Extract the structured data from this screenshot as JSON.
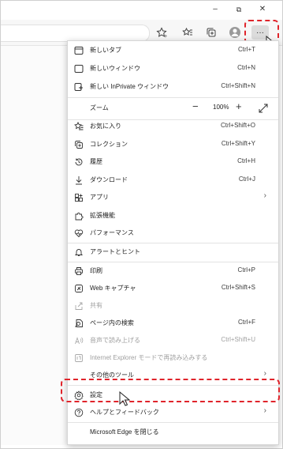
{
  "window": {
    "minimize": "–",
    "restore": "⧉",
    "close": "✕"
  },
  "toolbar": {
    "more_label": "···"
  },
  "menu": {
    "new_tab": {
      "label": "新しいタブ",
      "shortcut": "Ctrl+T"
    },
    "new_window": {
      "label": "新しいウィンドウ",
      "shortcut": "Ctrl+N"
    },
    "new_inprivate": {
      "label": "新しい InPrivate ウィンドウ",
      "shortcut": "Ctrl+Shift+N"
    },
    "zoom": {
      "label": "ズーム",
      "minus": "−",
      "value": "100%",
      "plus": "+"
    },
    "favorites": {
      "label": "お気に入り",
      "shortcut": "Ctrl+Shift+O"
    },
    "collections": {
      "label": "コレクション",
      "shortcut": "Ctrl+Shift+Y"
    },
    "history": {
      "label": "履歴",
      "shortcut": "Ctrl+H"
    },
    "downloads": {
      "label": "ダウンロード",
      "shortcut": "Ctrl+J"
    },
    "apps": {
      "label": "アプリ"
    },
    "extensions": {
      "label": "拡張機能"
    },
    "performance": {
      "label": "パフォーマンス"
    },
    "alerts": {
      "label": "アラートとヒント"
    },
    "print": {
      "label": "印刷",
      "shortcut": "Ctrl+P"
    },
    "web_capture": {
      "label": "Web キャプチャ",
      "shortcut": "Ctrl+Shift+S"
    },
    "share": {
      "label": "共有"
    },
    "find": {
      "label": "ページ内の検索",
      "shortcut": "Ctrl+F"
    },
    "read_aloud": {
      "label": "音声で読み上げる",
      "shortcut": "Ctrl+Shift+U"
    },
    "ie_mode": {
      "label": "Internet Explorer モードで再読み込みする"
    },
    "more_tools": {
      "label": "その他のツール"
    },
    "settings": {
      "label": "設定"
    },
    "help": {
      "label": "ヘルプとフィードバック"
    },
    "close_edge": {
      "label": "Microsoft Edge を閉じる"
    }
  },
  "colors": {
    "highlight": "#e0242b"
  }
}
